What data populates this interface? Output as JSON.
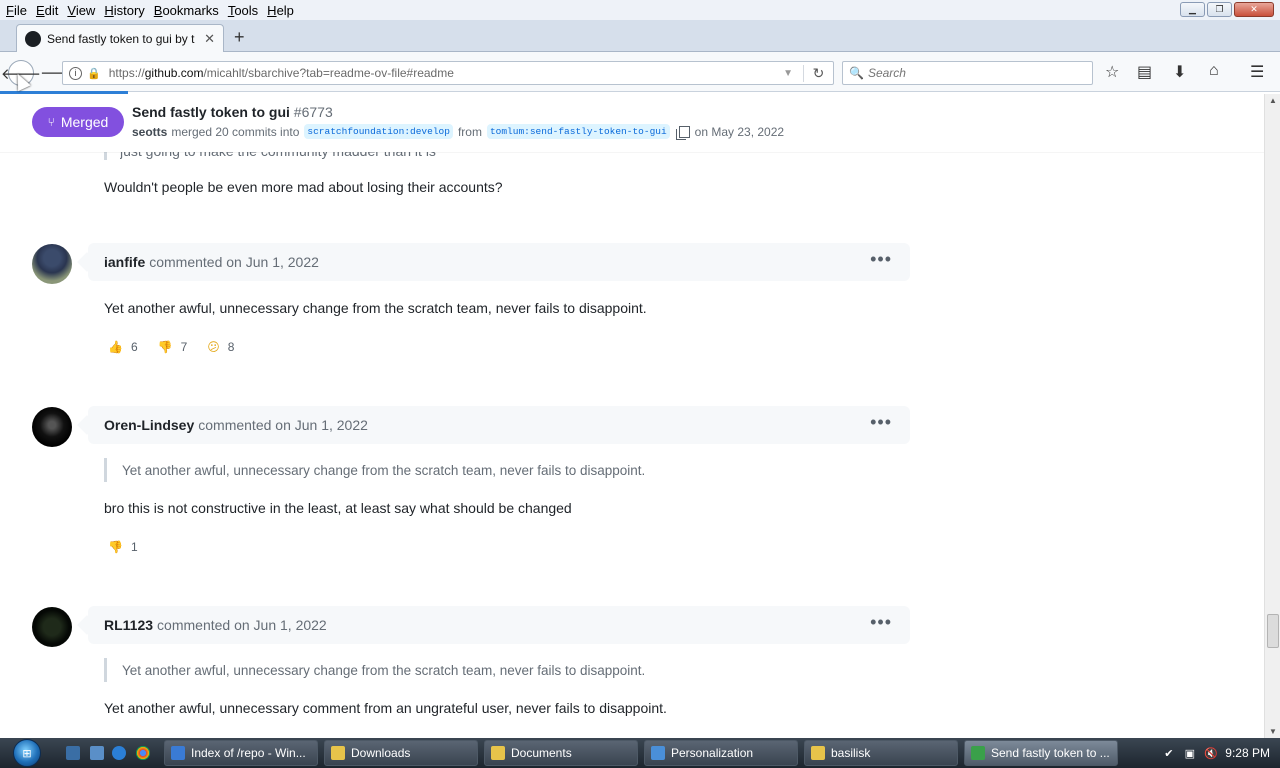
{
  "menubar": {
    "items": [
      {
        "label": "File",
        "u": "F",
        "rest": "ile"
      },
      {
        "label": "Edit",
        "u": "E",
        "rest": "dit"
      },
      {
        "label": "View",
        "u": "V",
        "rest": "iew"
      },
      {
        "label": "History",
        "u": "H",
        "rest": "istory"
      },
      {
        "label": "Bookmarks",
        "u": "B",
        "rest": "ookmarks"
      },
      {
        "label": "Tools",
        "u": "T",
        "rest": "ools"
      },
      {
        "label": "Help",
        "u": "H",
        "rest": "elp"
      }
    ]
  },
  "tab": {
    "title": "Send fastly token to gui by t",
    "close": "✕"
  },
  "navbar": {
    "url_prefix": "https://",
    "url_host": "github.com",
    "url_path": "/micahlt/sbarchive?tab=readme-ov-file#readme",
    "search_placeholder": "Search"
  },
  "pr": {
    "status": "Merged",
    "title": "Send fastly token to gui",
    "number": "#6773",
    "author": "seotts",
    "merged_text": "merged 20 commits into",
    "base_branch": "scratchfoundation:develop",
    "from_text": "from",
    "head_branch": "tomlum:send-fastly-token-to-gui",
    "date_text": "on May 23, 2022"
  },
  "thread": {
    "cut_quote": "just going to make the community madder than it is",
    "prior_reply": "Wouldn't people be even more mad about losing their accounts?",
    "comments": [
      {
        "author": "ianfife",
        "when": "commented on Jun 1, 2022",
        "body": "Yet another awful, unnecessary change from the scratch team, never fails to disappoint.",
        "reactions": [
          {
            "emoji": "👍",
            "count": "6"
          },
          {
            "emoji": "👎",
            "count": "7"
          },
          {
            "emoji": "😕",
            "count": "8"
          }
        ]
      },
      {
        "author": "Oren-Lindsey",
        "when": "commented on Jun 1, 2022",
        "quote": "Yet another awful, unnecessary change from the scratch team, never fails to disappoint.",
        "body": "bro this is not constructive in the least, at least say what should be changed",
        "reactions": [
          {
            "emoji": "👎",
            "count": "1"
          }
        ]
      },
      {
        "author": "RL1123",
        "when": "commented on Jun 1, 2022",
        "quote": "Yet another awful, unnecessary change from the scratch team, never fails to disappoint.",
        "body": "Yet another awful, unnecessary comment from an ungrateful user, never fails to disappoint."
      }
    ]
  },
  "taskbar": {
    "buttons": [
      {
        "label": "Index of /repo - Win...",
        "color": "#3a7bd5"
      },
      {
        "label": "Downloads",
        "color": "#e7c34a"
      },
      {
        "label": "Documents",
        "color": "#e7c34a"
      },
      {
        "label": "Personalization",
        "color": "#4a8fd8"
      },
      {
        "label": "basilisk",
        "color": "#e7c34a"
      },
      {
        "label": "Send fastly token to ...",
        "color": "#3aa04a"
      }
    ],
    "clock": "9:28 PM"
  },
  "colors": {
    "merged": "#8250df",
    "link": "#0969da",
    "branch_bg": "#ddf4ff"
  }
}
